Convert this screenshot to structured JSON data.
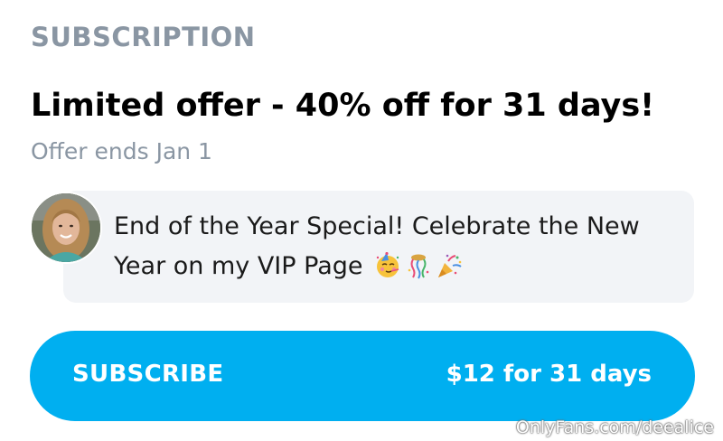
{
  "section_label": "SUBSCRIPTION",
  "offer": {
    "title": "Limited offer - 40% off for 31 days!",
    "ends": "Offer ends Jan 1"
  },
  "message": {
    "text": "End of the Year Special! Celebrate the New Year on my VIP Page",
    "emojis": [
      "partying-face-icon",
      "ribbon-confetti-icon",
      "party-popper-icon"
    ]
  },
  "subscribe": {
    "label": "SUBSCRIBE",
    "price": "$12 for 31 days"
  },
  "watermark": "OnlyFans.com/deealice",
  "colors": {
    "accent": "#00aff0",
    "muted_text": "#8a96a3",
    "message_bg": "#f2f4f7"
  }
}
